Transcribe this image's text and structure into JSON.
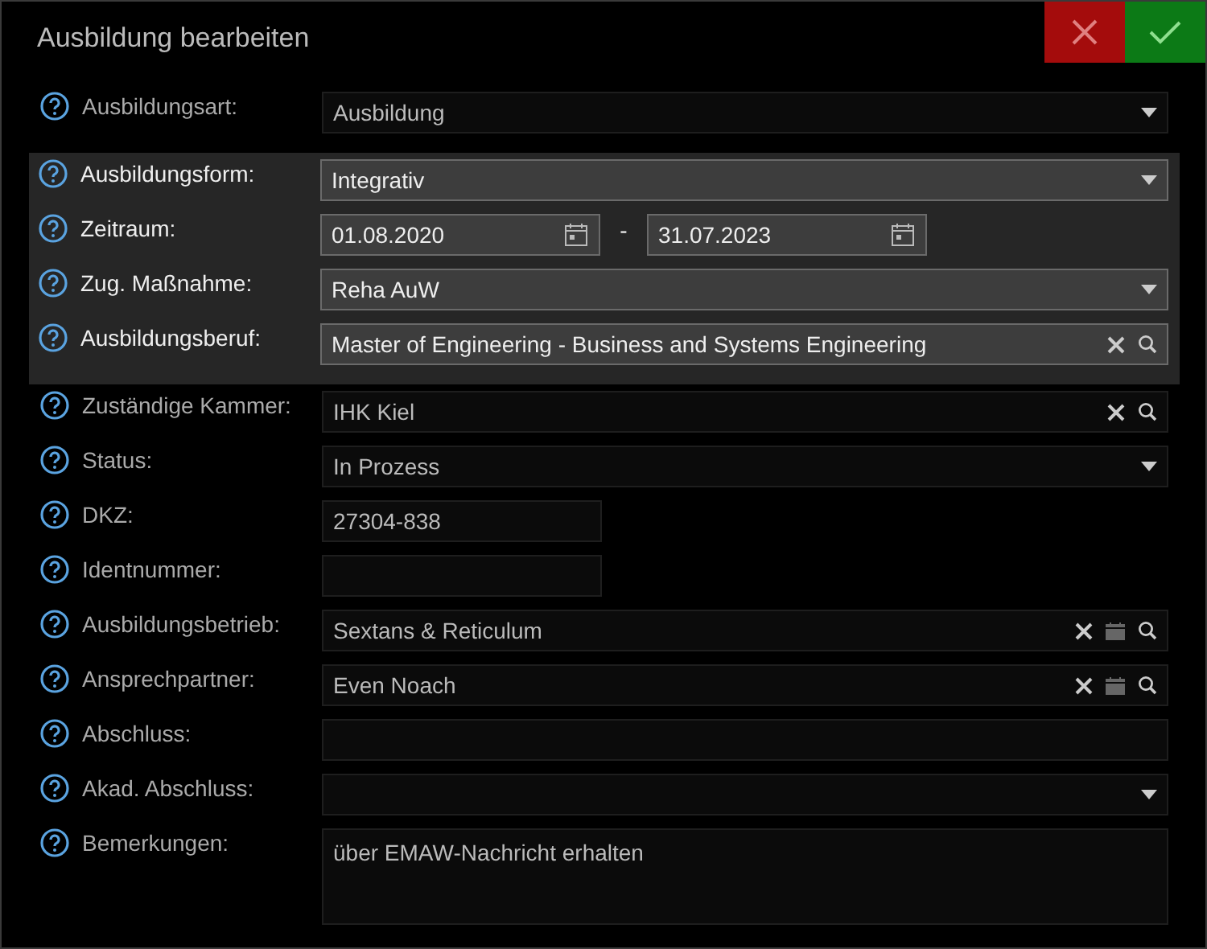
{
  "title": "Ausbildung bearbeiten",
  "rows": [
    {
      "label": "Ausbildungsart:",
      "kind": "select",
      "value": "Ausbildung",
      "highlighted": false
    },
    {
      "label": "Ausbildungsform:",
      "kind": "select",
      "value": "Integrativ",
      "highlighted": true
    },
    {
      "label": "Zeitraum:",
      "kind": "daterange",
      "from": "01.08.2020",
      "separator": "-",
      "to": "31.07.2023",
      "highlighted": true
    },
    {
      "label": "Zug. Maßnahme:",
      "kind": "select",
      "value": "Reha AuW",
      "highlighted": true
    },
    {
      "label": "Ausbildungsberuf:",
      "kind": "lookup",
      "value": "Master of Engineering - Business and Systems Engineering",
      "card": false,
      "highlighted": true
    },
    {
      "label": "Zuständige Kammer:",
      "kind": "lookup",
      "value": "IHK Kiel",
      "card": false,
      "highlighted": false
    },
    {
      "label": "Status:",
      "kind": "select",
      "value": "In Prozess",
      "highlighted": false
    },
    {
      "label": "DKZ:",
      "kind": "short",
      "value": "27304-838",
      "highlighted": false
    },
    {
      "label": "Identnummer:",
      "kind": "short",
      "highlighted": false
    },
    {
      "label": "Ausbildungsbetrieb:",
      "kind": "lookup",
      "value": "Sextans & Reticulum",
      "card": true,
      "highlighted": false
    },
    {
      "label": "Ansprechpartner:",
      "kind": "lookup",
      "value": "Even Noach",
      "card": true,
      "highlighted": false
    },
    {
      "label": "Abschluss:",
      "kind": "text",
      "highlighted": false
    },
    {
      "label": "Akad. Abschluss:",
      "kind": "select",
      "highlighted": false
    },
    {
      "label": "Bemerkungen:",
      "kind": "textarea",
      "value": "über EMAW-Nachricht erhalten",
      "highlighted": false
    }
  ]
}
